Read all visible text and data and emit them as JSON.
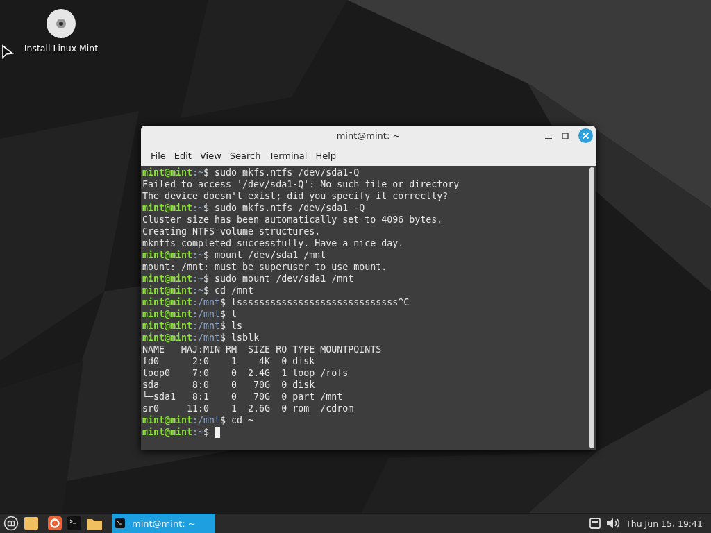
{
  "desktop": {
    "icons": [
      {
        "label": "Install Linux Mint"
      }
    ]
  },
  "window": {
    "title": "mint@mint: ~",
    "menu": [
      "File",
      "Edit",
      "View",
      "Search",
      "Terminal",
      "Help"
    ],
    "lines": [
      {
        "kind": "prompt",
        "user": "mint@mint",
        "path": ":~",
        "command": "$ sudo mkfs.ntfs /dev/sda1-Q"
      },
      {
        "kind": "output",
        "text": "Failed to access '/dev/sda1-Q': No such file or directory"
      },
      {
        "kind": "output",
        "text": "The device doesn't exist; did you specify it correctly?"
      },
      {
        "kind": "prompt",
        "user": "mint@mint",
        "path": ":~",
        "command": "$ sudo mkfs.ntfs /dev/sda1 -Q"
      },
      {
        "kind": "output",
        "text": "Cluster size has been automatically set to 4096 bytes."
      },
      {
        "kind": "output",
        "text": "Creating NTFS volume structures."
      },
      {
        "kind": "output",
        "text": "mkntfs completed successfully. Have a nice day."
      },
      {
        "kind": "prompt",
        "user": "mint@mint",
        "path": ":~",
        "command": "$ mount /dev/sda1 /mnt"
      },
      {
        "kind": "output",
        "text": "mount: /mnt: must be superuser to use mount."
      },
      {
        "kind": "prompt",
        "user": "mint@mint",
        "path": ":~",
        "command": "$ sudo mount /dev/sda1 /mnt"
      },
      {
        "kind": "prompt",
        "user": "mint@mint",
        "path": ":~",
        "command": "$ cd /mnt"
      },
      {
        "kind": "prompt",
        "user": "mint@mint",
        "path": ":/mnt",
        "command": "$ lsssssssssssssssssssssssssssss^C"
      },
      {
        "kind": "prompt",
        "user": "mint@mint",
        "path": ":/mnt",
        "command": "$ l"
      },
      {
        "kind": "prompt",
        "user": "mint@mint",
        "path": ":/mnt",
        "command": "$ ls"
      },
      {
        "kind": "prompt",
        "user": "mint@mint",
        "path": ":/mnt",
        "command": "$ lsblk"
      },
      {
        "kind": "output",
        "text": "NAME   MAJ:MIN RM  SIZE RO TYPE MOUNTPOINTS"
      },
      {
        "kind": "output",
        "text": "fd0      2:0    1    4K  0 disk "
      },
      {
        "kind": "output",
        "text": "loop0    7:0    0  2.4G  1 loop /rofs"
      },
      {
        "kind": "output",
        "text": "sda      8:0    0   70G  0 disk "
      },
      {
        "kind": "output",
        "text": "└─sda1   8:1    0   70G  0 part /mnt"
      },
      {
        "kind": "output",
        "text": "sr0     11:0    1  2.6G  0 rom  /cdrom"
      },
      {
        "kind": "prompt",
        "user": "mint@mint",
        "path": ":/mnt",
        "command": "$ cd ~"
      },
      {
        "kind": "prompt",
        "user": "mint@mint",
        "path": ":~",
        "command": "$ ",
        "cursor": true
      }
    ]
  },
  "taskbar": {
    "window_button": {
      "label": "mint@mint: ~",
      "selected": true
    },
    "clock": "Thu Jun 15, 19:41"
  }
}
